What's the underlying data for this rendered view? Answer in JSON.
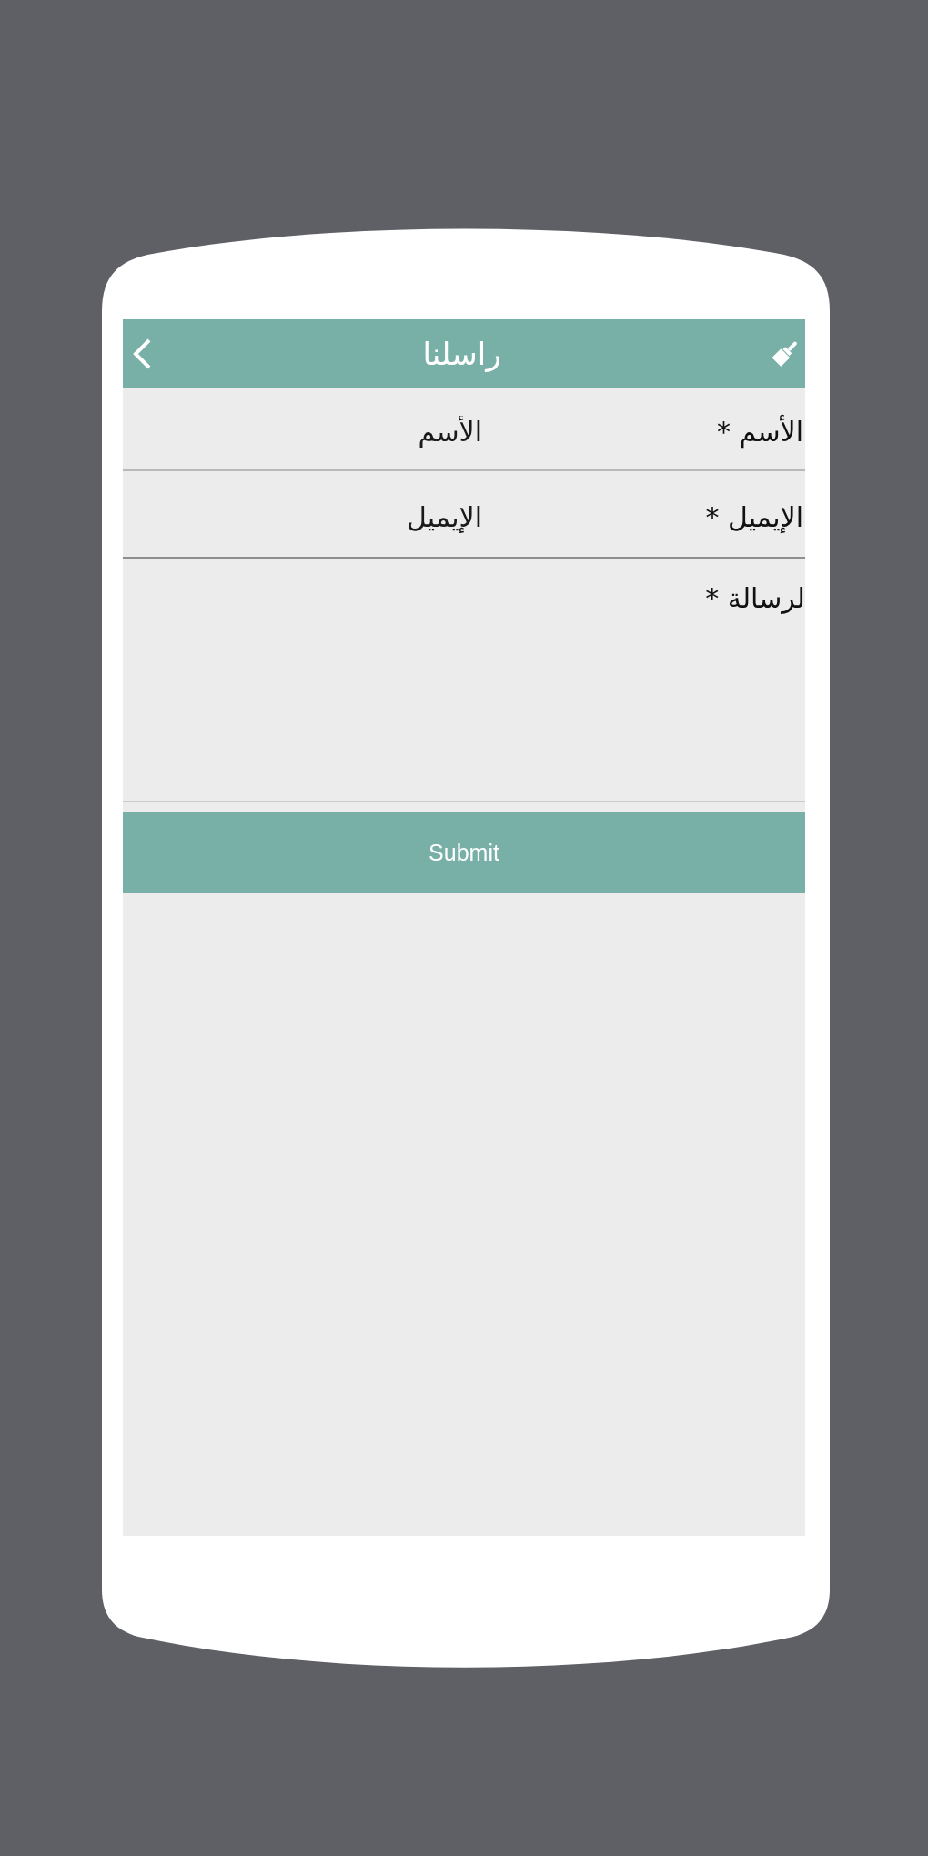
{
  "header": {
    "title": "راسلنا"
  },
  "form": {
    "fields": [
      {
        "kind": "text",
        "label": "الأسم *",
        "placeholder": "الأسم"
      },
      {
        "kind": "text",
        "label": "الإيميل *",
        "placeholder": "الإيميل"
      },
      {
        "kind": "textarea",
        "label": "لرسالة *"
      }
    ]
  },
  "submit_button": {
    "label": "Submit"
  }
}
